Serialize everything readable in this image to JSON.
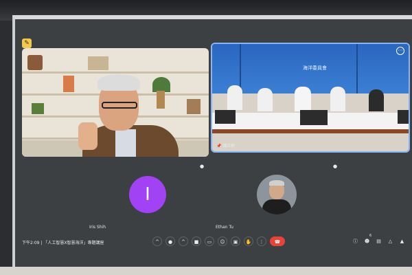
{
  "meeting": {
    "time": "下午2:09",
    "separator": "|",
    "title": "「人工智慧X智慧海洋」專題講座"
  },
  "participants": [
    {
      "name": "",
      "role": "speaker",
      "muted": false
    },
    {
      "name": "陳正軒",
      "role": "room",
      "muted": false
    },
    {
      "name": "Iris Shih",
      "initial": "I",
      "avatar_color": "#a142f4",
      "muted": true
    },
    {
      "name": "Ethan Tu",
      "muted": true
    }
  ],
  "room_sign": "海洋委員會",
  "people_badge": "6",
  "icons": {
    "pin": "pin-icon",
    "more": "more-vert-icon",
    "mic_off": "mic-off-icon",
    "controls": [
      "chevron-up-icon",
      "mic-icon",
      "chevron-up-icon",
      "camera-icon",
      "captions-icon",
      "emoji-icon",
      "present-icon",
      "hand-icon",
      "more-vert-icon",
      "end-call-icon"
    ],
    "right": [
      "info-icon",
      "people-icon",
      "chat-icon",
      "activities-icon",
      "lock-icon"
    ]
  },
  "colors": {
    "end_call": "#ea4335",
    "avatar": "#a142f4",
    "active_border": "#8ab4f8"
  }
}
